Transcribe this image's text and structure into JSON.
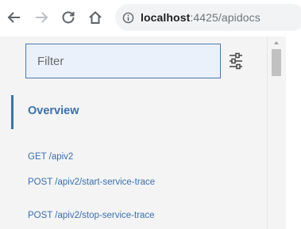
{
  "browser": {
    "url_host": "localhost",
    "url_rest": ":4425/apidocs",
    "icons": {
      "back": "back-arrow-icon",
      "forward": "forward-arrow-icon",
      "reload": "reload-icon",
      "home": "home-icon",
      "info": "info-icon"
    }
  },
  "sidebar": {
    "filter": {
      "placeholder": "Filter",
      "value": ""
    },
    "filter_settings_icon": "sliders-icon",
    "items": [
      {
        "label": "Overview",
        "active": true
      },
      {
        "label": "GET /apiv2",
        "active": false
      },
      {
        "label": "POST /apiv2/start-service-trace",
        "active": false
      },
      {
        "label": "POST /apiv2/stop-service-trace",
        "active": false
      }
    ]
  },
  "colors": {
    "link": "#3a6fb0",
    "active_marker": "#3c72b0",
    "filter_border": "#4b79b0",
    "sidebar_bg": "#f4f4f4"
  }
}
